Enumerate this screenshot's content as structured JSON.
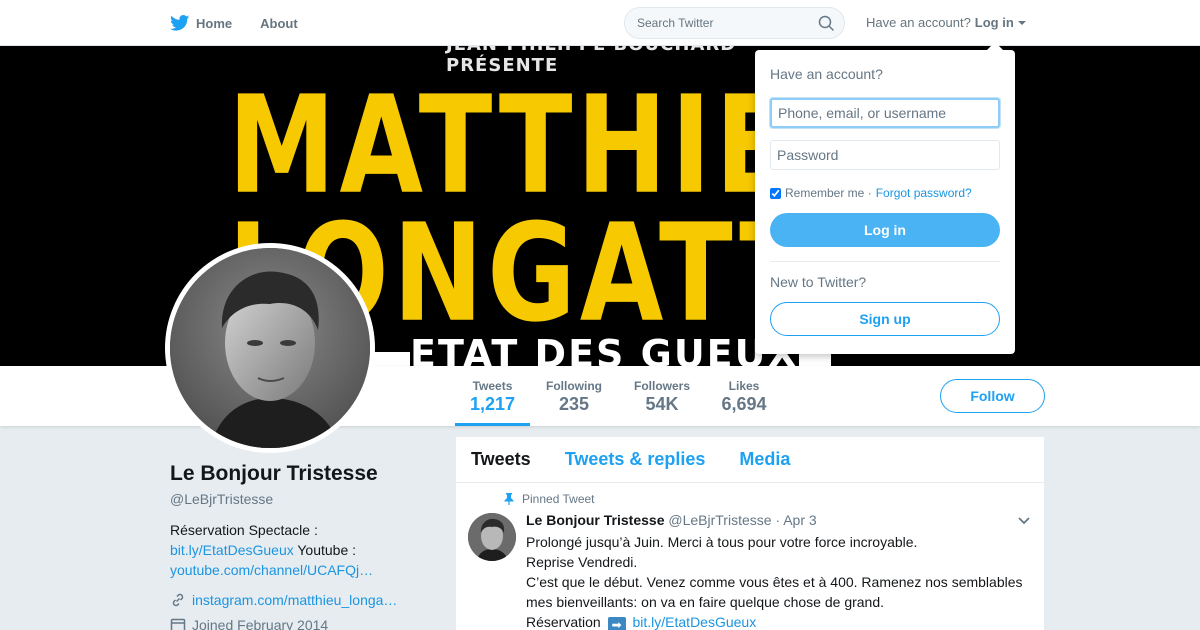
{
  "nav": {
    "home_label": "Home",
    "about_label": "About",
    "search_placeholder": "Search Twitter",
    "account_prompt": "Have an account?",
    "login_label": "Log in"
  },
  "banner": {
    "top_text": "JEAN-PHILIPPE BOUCHARD PRÉSENTE",
    "line1": "MATTHIEU",
    "line2": "LONGATTE",
    "bottom_text": "ETAT DES GUEUX"
  },
  "stats": [
    {
      "label": "Tweets",
      "value": "1,217"
    },
    {
      "label": "Following",
      "value": "235"
    },
    {
      "label": "Followers",
      "value": "54K"
    },
    {
      "label": "Likes",
      "value": "6,694"
    }
  ],
  "follow_label": "Follow",
  "profile": {
    "name": "Le Bonjour Tristesse",
    "handle": "@LeBjrTristesse",
    "bio_prefix": "Réservation Spectacle :",
    "bio_link1": "bit.ly/EtatDesGueux",
    "bio_mid": " Youtube :",
    "bio_link2": "youtube.com/channel/UCAFQj…",
    "website": "instagram.com/matthieu_longa…",
    "joined": "Joined February 2014"
  },
  "timeline": {
    "tabs": [
      "Tweets",
      "Tweets & replies",
      "Media"
    ],
    "pinned_label": "Pinned Tweet",
    "tweet": {
      "name": "Le Bonjour Tristesse",
      "handle": "@LeBjrTristesse",
      "date": "· Apr 3",
      "line1": "Prolongé jusqu’à Juin. Merci à tous pour votre force incroyable.",
      "line2": "Reprise Vendredi.",
      "line3": "C’est que le début. Venez comme vous êtes et à 400. Ramenez nos semblables mes bienveillants: on va en faire quelque chose de grand.",
      "line4_prefix": "Réservation",
      "line4_link": "bit.ly/EtatDesGueux"
    }
  },
  "login_dropdown": {
    "title": "Have an account?",
    "username_placeholder": "Phone, email, or username",
    "password_placeholder": "Password",
    "remember_label": "Remember me ·",
    "forgot_label": "Forgot password?",
    "login_button": "Log in",
    "new_label": "New to Twitter?",
    "signup_button": "Sign up"
  },
  "colors": {
    "accent": "#1da1f2",
    "login_button": "#4ab3f4",
    "banner_yellow": "#f7c900"
  }
}
